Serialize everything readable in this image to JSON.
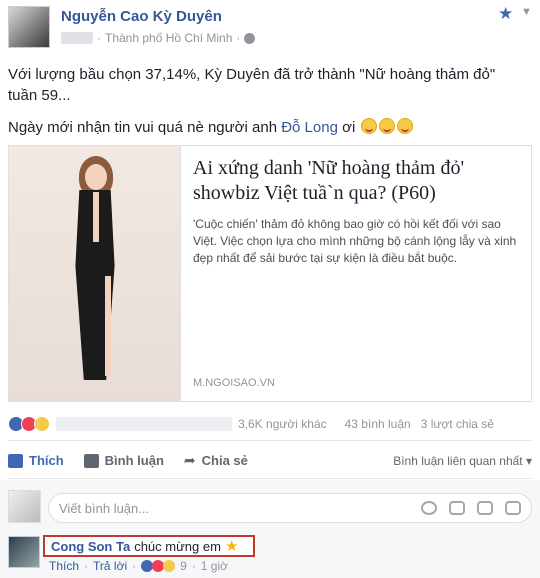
{
  "post": {
    "author": "Nguyễn Cao Kỳ Duyên",
    "location": "Thành phố Hồ Chí Minh",
    "paragraph1": "Với lượng bầu chọn 37,14%, Kỳ Duyên đã trở thành \"Nữ hoàng thảm đỏ\" tuần 59...",
    "paragraph2_prefix": "Ngày mới nhận tin vui quá nè người anh ",
    "paragraph2_link": "Đỗ Long",
    "paragraph2_suffix": " ơi"
  },
  "link_card": {
    "title": "Ai xứng danh 'Nữ hoàng thảm đỏ' showbiz Việt tuầ`n qua? (P60)",
    "description": "'Cuộc chiến' thảm đỏ không bao giờ có hồi kết đối với sao Việt. Việc chọn lựa cho mình những bộ cánh lộng lẫy và xinh đẹp nhất để sải bước tại sự kiện là điều bắt buộc.",
    "source": "M.NGOISAO.VN"
  },
  "stats": {
    "others": "3,6K người khác",
    "comments": "43 bình luận",
    "shares": "3 lượt chia sẻ"
  },
  "actions": {
    "like": "Thích",
    "comment": "Bình luận",
    "share": "Chia sẻ",
    "related": "Bình luận liên quan nhất ▾"
  },
  "comment_input": {
    "placeholder": "Viết bình luận..."
  },
  "comment": {
    "author": "Cong Son Ta",
    "text": "chúc mừng em",
    "like": "Thích",
    "reply": "Trả lời",
    "count": "9",
    "time": "1 giờ"
  },
  "colors": {
    "link": "#365899",
    "highlight_border": "#c0392b"
  }
}
